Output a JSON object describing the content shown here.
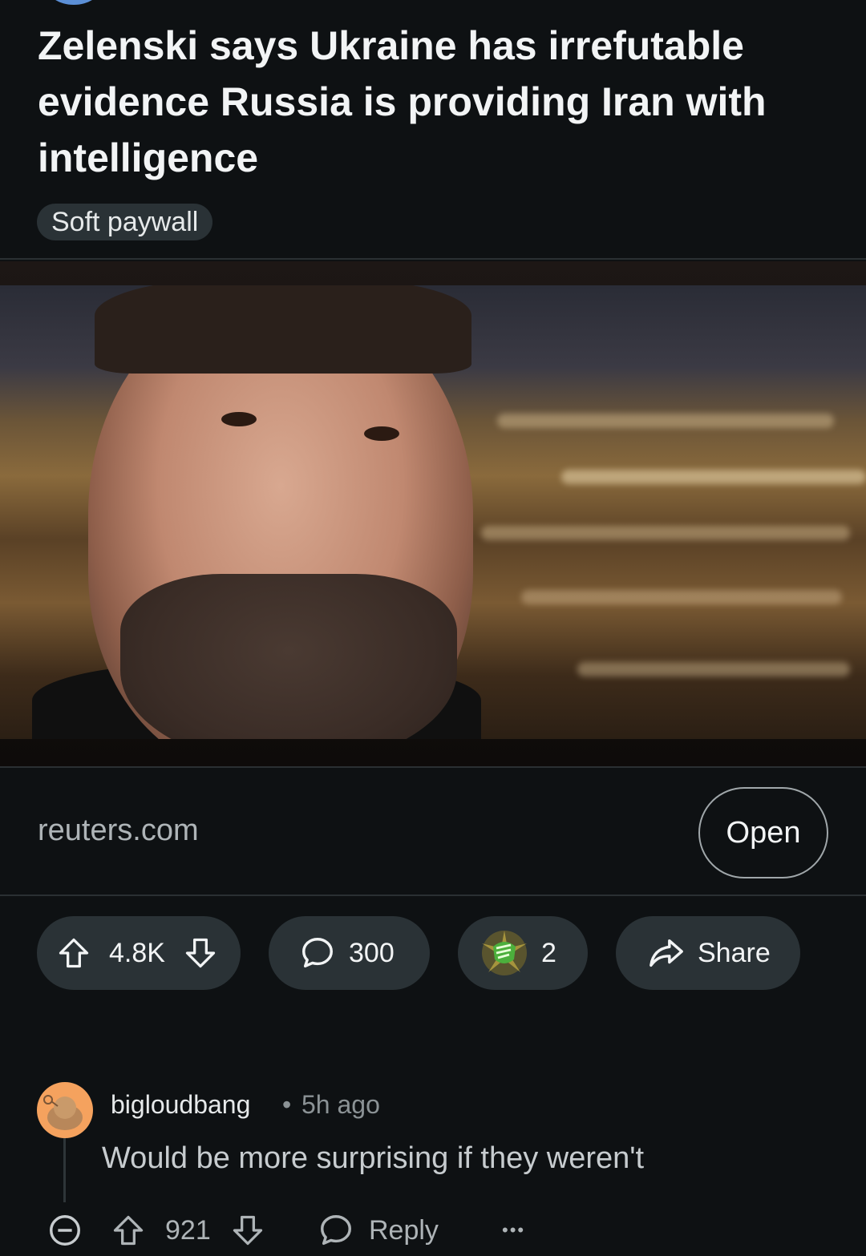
{
  "post": {
    "title": "Zelenski says Ukraine has irrefutable evidence Russia is providing Iran with intelligence",
    "flair": "Soft paywall",
    "link_domain": "reuters.com",
    "open_label": "Open"
  },
  "actions": {
    "vote_count": "4.8K",
    "comment_count": "300",
    "award_count": "2",
    "share_label": "Share"
  },
  "comment": {
    "username": "bigloudbang",
    "separator": "•",
    "time": "5h ago",
    "body": "Would be more surprising if they weren't",
    "vote_count": "921",
    "reply_label": "Reply",
    "more_label": "•••"
  },
  "colors": {
    "background": "#0e1113",
    "pill": "#2a3236",
    "avatar": "#f5a25e"
  }
}
